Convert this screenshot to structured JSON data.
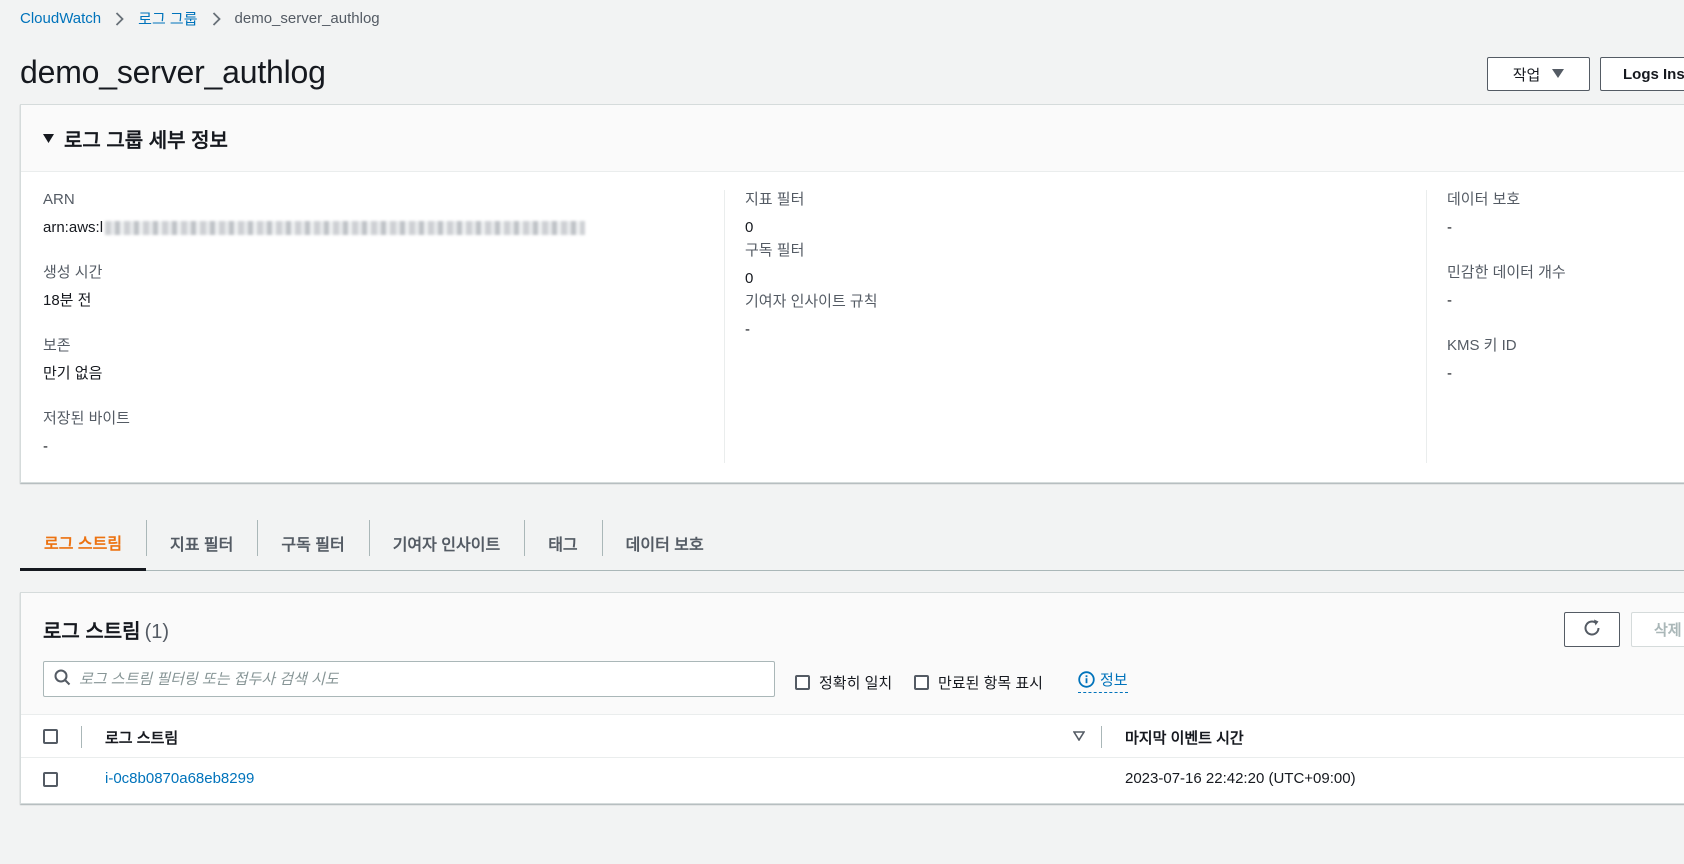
{
  "breadcrumb": {
    "items": [
      "CloudWatch",
      "로그 그룹"
    ],
    "current": "demo_server_authlog"
  },
  "header": {
    "title": "demo_server_authlog",
    "actions_label": "작업",
    "insights_label": "Logs Ins"
  },
  "details": {
    "heading": "로그 그룹 세부 정보",
    "col1": [
      {
        "label": "ARN",
        "value": "arn:aws:l"
      },
      {
        "label": "생성 시간",
        "value": "18분 전"
      },
      {
        "label": "보존",
        "value": "만기 없음"
      },
      {
        "label": "저장된 바이트",
        "value": "-"
      }
    ],
    "col2": [
      {
        "label": "지표 필터",
        "value": "0"
      },
      {
        "label": "구독 필터",
        "value": "0"
      },
      {
        "label": "기여자 인사이트 규칙",
        "value": "-"
      }
    ],
    "col3": [
      {
        "label": "데이터 보호",
        "value": "-"
      },
      {
        "label": "민감한 데이터 개수",
        "value": "-"
      },
      {
        "label": "KMS 키 ID",
        "value": "-"
      }
    ]
  },
  "tabs": [
    "로그 스트림",
    "지표 필터",
    "구독 필터",
    "기여자 인사이트",
    "태그",
    "데이터 보호"
  ],
  "streams": {
    "title": "로그 스트림",
    "count": "(1)",
    "delete_label": "삭제",
    "search_placeholder": "로그 스트림 필터링 또는 접두사 검색 시도",
    "exact_match_label": "정확히 일치",
    "show_expired_label": "만료된 항목 표시",
    "info_label": "정보",
    "columns": {
      "name": "로그 스트림",
      "last_event": "마지막 이벤트 시간"
    },
    "rows": [
      {
        "name": "i-0c8b0870a68eb8299",
        "last_event": "2023-07-16 22:42:20 (UTC+09:00)"
      }
    ]
  },
  "colors": {
    "link": "#0073bb",
    "active_tab": "#ec7211",
    "background": "#f2f3f3"
  }
}
